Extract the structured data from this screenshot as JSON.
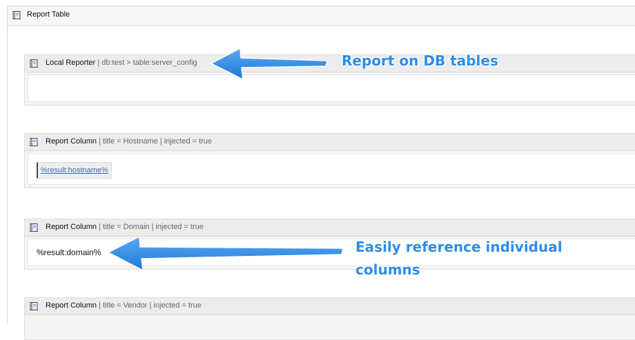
{
  "outer": {
    "title": "Report Table",
    "icon": "book-icon"
  },
  "blocks": [
    {
      "name": "Local Reporter",
      "meta": " | db:test > table:server_config",
      "value": ""
    },
    {
      "name": "Report Column",
      "meta": " | title = Hostname | injected = true",
      "value": "%result:hostname%"
    },
    {
      "name": "Report Column",
      "meta": " | title = Domain | injected = true",
      "value": "%result:domain%"
    },
    {
      "name": "Report Column",
      "meta": " | title = Vendor | injected = true",
      "value": ""
    }
  ],
  "annotations": {
    "db_tables": "Report on DB tables",
    "columns_line1": "Easily reference individual",
    "columns_line2": "columns",
    "color": "#2e8de6"
  }
}
